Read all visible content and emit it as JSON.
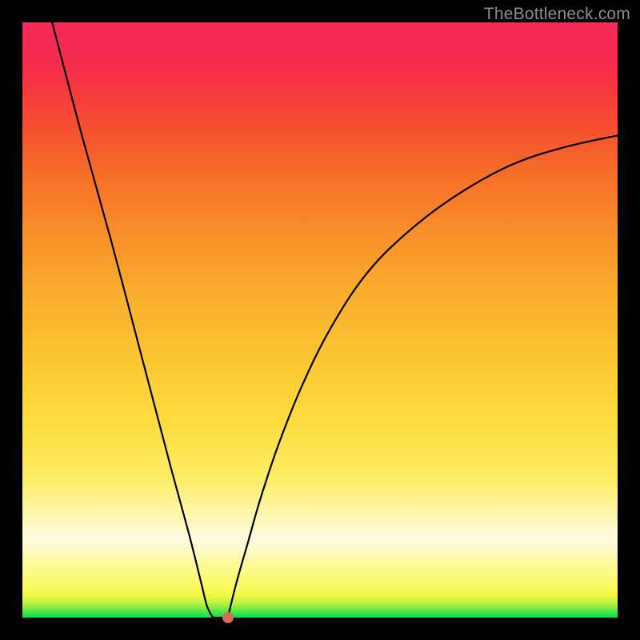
{
  "watermark": "TheBottleneck.com",
  "colors": {
    "curve": "#000000",
    "marker": "#d86b5a",
    "frame": "#000000"
  },
  "chart_data": {
    "type": "line",
    "title": "",
    "xlabel": "",
    "ylabel": "",
    "xlim": [
      0,
      100
    ],
    "ylim": [
      0,
      100
    ],
    "grid": false,
    "legend": false,
    "series": [
      {
        "name": "left-branch",
        "x": [
          5,
          10,
          15,
          20,
          25,
          28,
          30,
          31,
          32
        ],
        "y": [
          100,
          81,
          63,
          44,
          25,
          14,
          6,
          2,
          0
        ]
      },
      {
        "name": "valley-flat",
        "x": [
          32,
          34.5
        ],
        "y": [
          0,
          0
        ]
      },
      {
        "name": "right-branch",
        "x": [
          34.5,
          36,
          38,
          40,
          43,
          47,
          52,
          58,
          65,
          73,
          82,
          91,
          100
        ],
        "y": [
          0,
          6,
          13,
          20,
          29,
          39,
          49,
          58,
          65,
          71,
          76,
          79,
          81
        ]
      }
    ],
    "marker": {
      "x": 34.5,
      "y": 0
    },
    "gradient_stops": [
      {
        "pos": 0.0,
        "color": "#00e04d"
      },
      {
        "pos": 0.03,
        "color": "#d5f544"
      },
      {
        "pos": 0.12,
        "color": "#fefbd0"
      },
      {
        "pos": 0.24,
        "color": "#fdec60"
      },
      {
        "pos": 0.54,
        "color": "#faae2d"
      },
      {
        "pos": 0.82,
        "color": "#f6502e"
      },
      {
        "pos": 1.0,
        "color": "#f52a5a"
      }
    ]
  }
}
